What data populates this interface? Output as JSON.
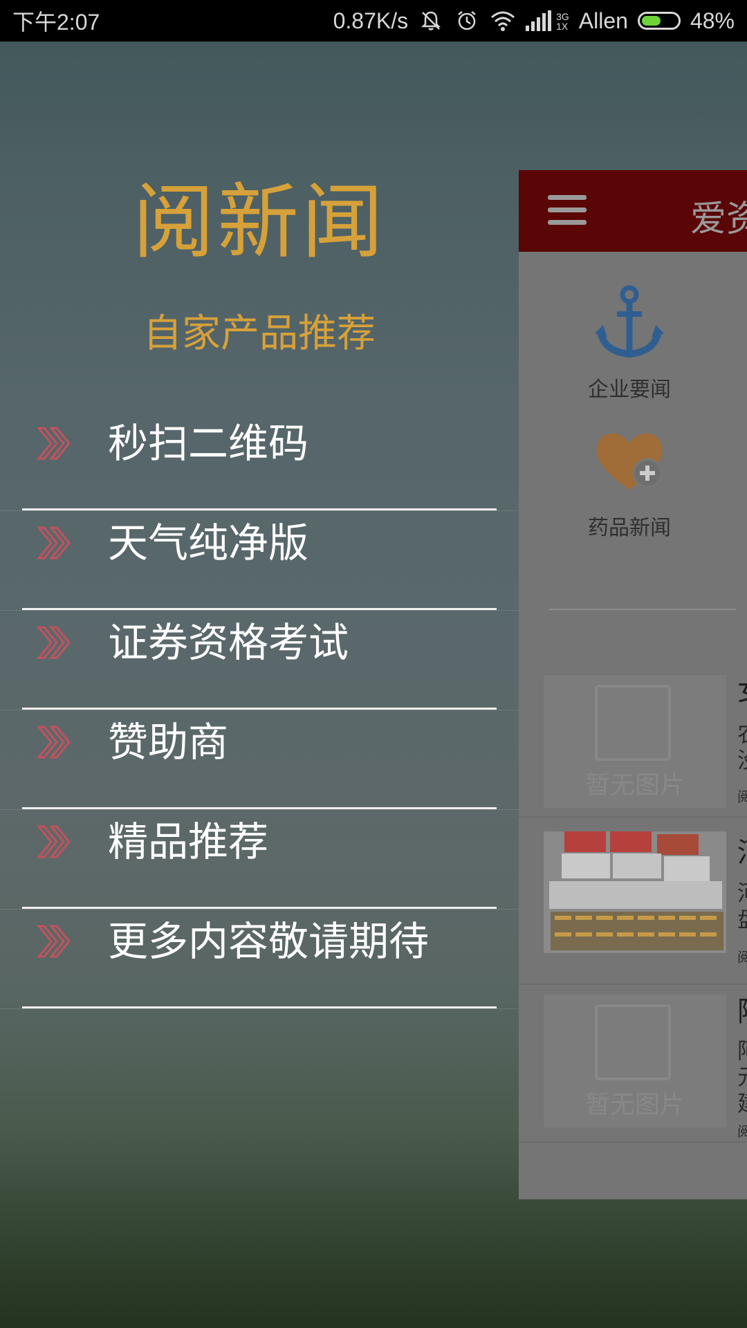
{
  "status_bar": {
    "time": "下午2:07",
    "speed": "0.87K/s",
    "signal_type_top": "3G",
    "signal_type_bottom": "1X",
    "carrier": "Allen",
    "battery": "48%",
    "battery_level": 0.48,
    "battery_color": "#6cd43a"
  },
  "drawer": {
    "title": "阅新闻",
    "subtitle": "自家产品推荐",
    "accent_color": "#d7a13a",
    "items": [
      {
        "label": "秒扫二维码",
        "icon": "double-chevron-right-icon"
      },
      {
        "label": "天气纯净版",
        "icon": "double-chevron-right-icon"
      },
      {
        "label": "证券资格考试",
        "icon": "double-chevron-right-icon"
      },
      {
        "label": "赞助商",
        "icon": "double-chevron-right-icon"
      },
      {
        "label": "精品推荐",
        "icon": "double-chevron-right-icon"
      },
      {
        "label": "更多内容敬请期待",
        "icon": "double-chevron-right-icon"
      }
    ]
  },
  "preview": {
    "title": "爱资",
    "topbar_color": "#5a0606",
    "categories": [
      {
        "label": "企业要闻",
        "icon": "anchor-icon"
      },
      {
        "label": "药品新闻",
        "icon": "heart-plus-icon"
      }
    ],
    "news": [
      {
        "title": "女",
        "line1": "农",
        "line2": "没",
        "source": "阅",
        "thumb": "暂无图片"
      },
      {
        "title": "河",
        "line1": "河",
        "line2": "盘",
        "source": "阅",
        "thumb": ""
      },
      {
        "title": "阿",
        "line1": "阿",
        "line2": "元",
        "line3": "建",
        "source": "阅",
        "thumb": "暂无图片"
      }
    ]
  }
}
